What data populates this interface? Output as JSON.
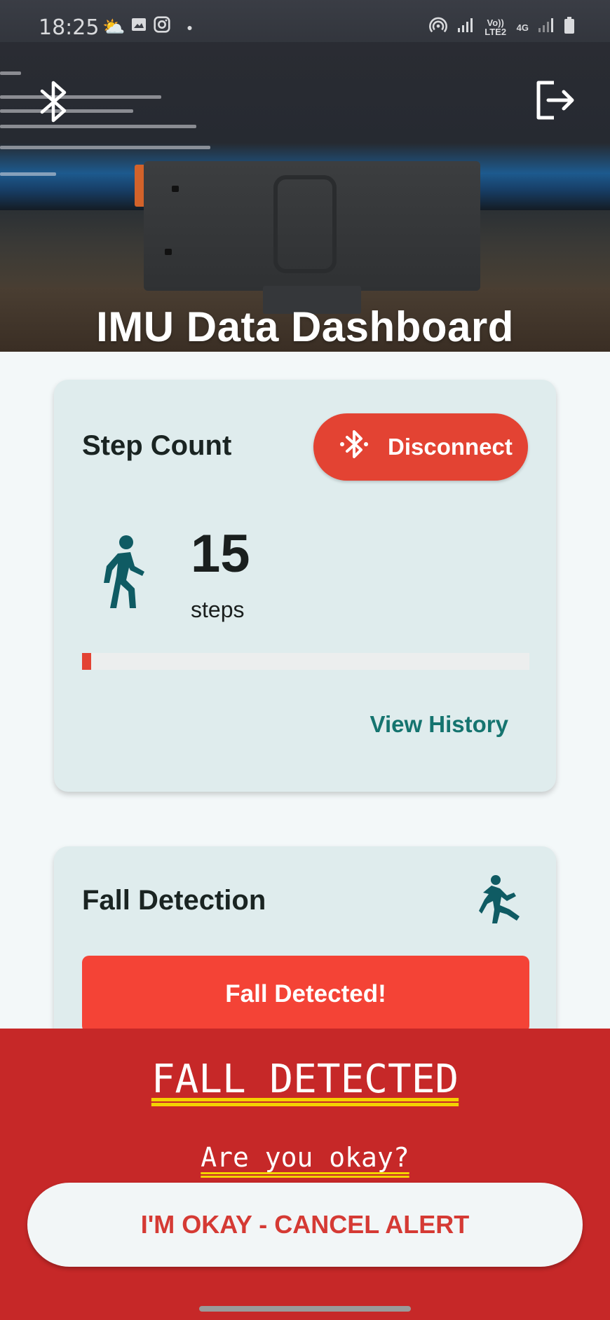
{
  "status_bar": {
    "time": "18:25",
    "left_icons": [
      "weather-icon",
      "gallery-icon",
      "instagram-icon",
      "dot"
    ],
    "right_icons": [
      "hotspot-icon",
      "signal-icon",
      "volte-icon",
      "4g-icon",
      "signal-icon",
      "battery-icon"
    ],
    "volte_label": "Vo)) LTE2",
    "network_label": "4G"
  },
  "header": {
    "title": "IMU Data Dashboard",
    "left_icon": "bluetooth-icon",
    "right_icon": "logout-icon"
  },
  "step_card": {
    "title": "Step Count",
    "disconnect_label": "Disconnect",
    "step_value": "15",
    "step_unit": "steps",
    "progress_fraction": 0.003,
    "view_history_label": "View History"
  },
  "fall_card": {
    "title": "Fall Detection",
    "status_button_label": "Fall Detected!"
  },
  "alert": {
    "title": "FALL DETECTED",
    "subtitle": "Are you okay?",
    "cancel_label": "I'M OKAY - CANCEL ALERT"
  },
  "colors": {
    "accent_red": "#e34333",
    "alert_red": "#c62828",
    "teal": "#15746f",
    "card_bg": "#dfeced"
  }
}
